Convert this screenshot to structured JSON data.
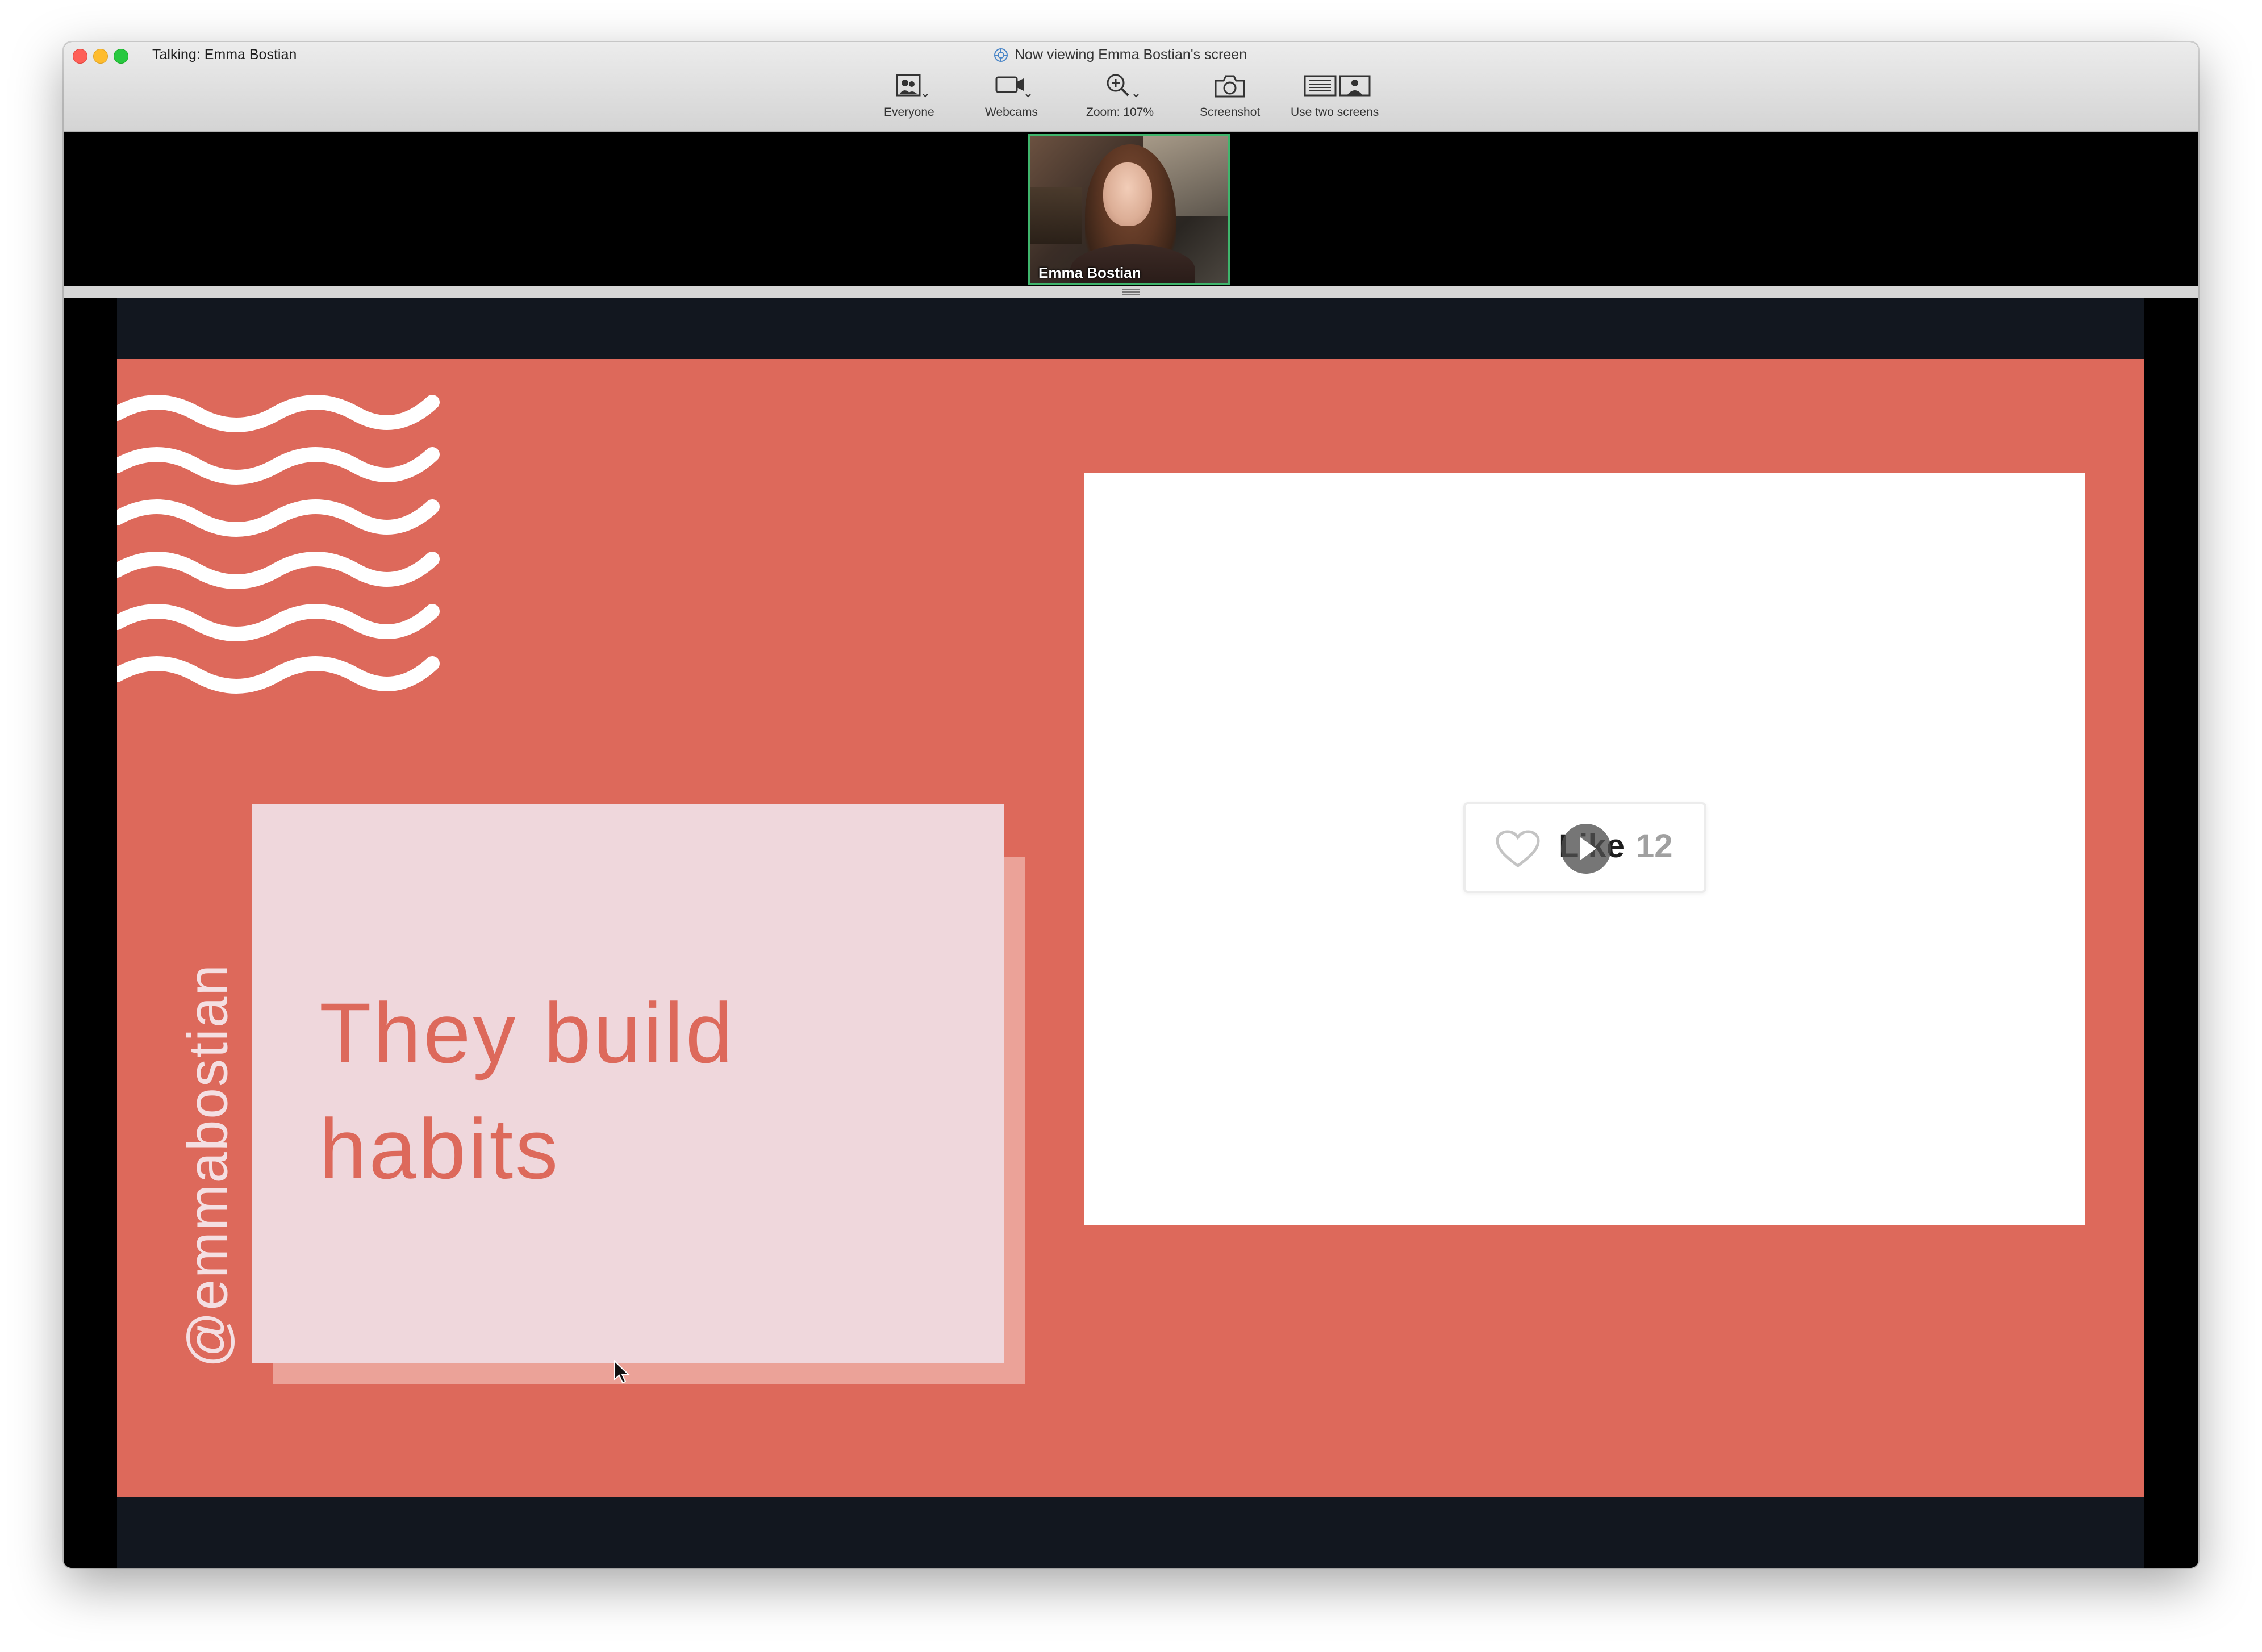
{
  "window": {
    "talking_status": "Talking: Emma Bostian",
    "viewing_status": "Now viewing Emma Bostian's screen"
  },
  "toolbar": {
    "everyone_label": "Everyone",
    "webcams_label": "Webcams",
    "zoom_label": "Zoom: 107%",
    "screenshot_label": "Screenshot",
    "two_screens_label": "Use two screens"
  },
  "webcam": {
    "participant_name": "Emma Bostian",
    "active_border_color": "#3fb56c"
  },
  "slide": {
    "handle": "@emmabostian",
    "headline_line1": "They build",
    "headline_line2": "habits",
    "background_color": "#dd695b",
    "card_color": "#efd7dc"
  },
  "demo": {
    "like_label": "Like",
    "like_count": "12"
  }
}
